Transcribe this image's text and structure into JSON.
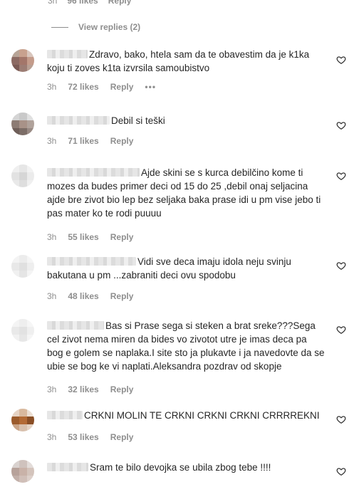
{
  "top_meta": {
    "time": "3h",
    "likes": "96 likes",
    "reply": "Reply"
  },
  "view_replies": "View replies (2)",
  "comments": [
    {
      "text": "Zdravo, bako, htela sam da te obavestim da je k1ka koju ti zoves k1ta izvrsila samoubistvo",
      "time": "3h",
      "likes": "72 likes",
      "reply": "Reply",
      "more": "•••"
    },
    {
      "text": "Debil si teški",
      "time": "3h",
      "likes": "71 likes",
      "reply": "Reply"
    },
    {
      "text": "Ajde skini se s kurca debilčino kome ti mozes da budes primer deci od 15 do 25 ,debil onaj seljacina ajde bre zivot bio lep bez seljaka baka prase idi u pm vise jebo ti pas mater ko te rodi puuuu",
      "time": "3h",
      "likes": "55 likes",
      "reply": "Reply"
    },
    {
      "text": "Vidi sve deca imaju idola neju svinju bakutana u pm ...zabraniti deci ovu spodobu",
      "time": "3h",
      "likes": "48 likes",
      "reply": "Reply"
    },
    {
      "text": "Bas si Prase sega si steken a brat sreke???Sega cel zivot nema miren da bides vo zivotot utre je imas deca pa bog e golem se naplaka.I site sto ja plukavte i ja navedovte da se ubie se bog ke vi naplati.Aleksandra pozdrav od skopje",
      "time": "3h",
      "likes": "32 likes",
      "reply": "Reply"
    },
    {
      "text": "CRKNI MOLIN TE CRKNI CRKNI CRKNI CRRRREKNI",
      "time": "3h",
      "likes": "53 likes",
      "reply": "Reply"
    },
    {
      "text": "Sram te bilo devojka se ubila zbog tebe !!!!"
    }
  ],
  "icons": {
    "heart": "heart-outline-icon",
    "avatar": "pixelated-avatar"
  },
  "colors": {
    "text": "#262626",
    "muted": "#8e8e8e"
  }
}
